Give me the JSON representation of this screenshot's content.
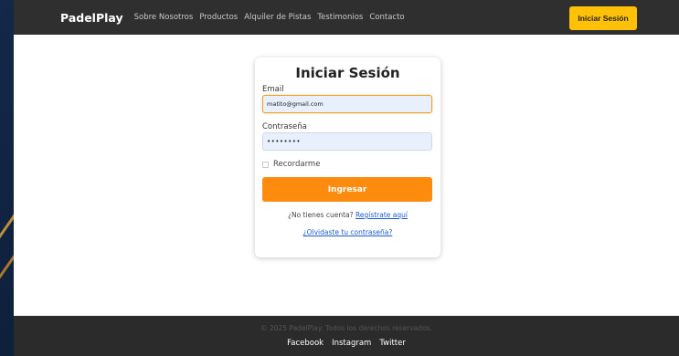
{
  "navbar": {
    "brand": "PadelPlay",
    "links": [
      "Sobre Nosotros",
      "Productos",
      "Alquiler de Pistas",
      "Testimonios",
      "Contacto"
    ],
    "login_button": "Iniciar Sesión"
  },
  "login_form": {
    "title": "Iniciar Sesión",
    "email_label": "Email",
    "email_value": "matito@gmail.com",
    "password_label": "Contraseña",
    "password_value": "••••••••",
    "remember_label": "Recordarme",
    "remember_checked": false,
    "submit_label": "Ingresar",
    "register_prompt": "¿No tienes cuenta?",
    "register_link": "Regístrate aquí",
    "forgot_link": "¿Olvidaste tu contraseña?"
  },
  "footer": {
    "copyright": "© 2025 PadelPlay. Todos los derechos reservados.",
    "social": [
      "Facebook",
      "Instagram",
      "Twitter"
    ]
  },
  "colors": {
    "accent": "#ffc107",
    "submit": "#fd8c0e",
    "link": "#1a5bd6",
    "header_bg": "#2f2f2f"
  }
}
